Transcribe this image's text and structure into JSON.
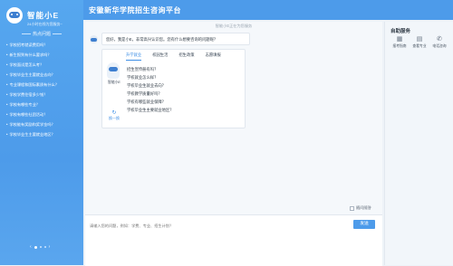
{
  "sidebar": {
    "brand_name": "智能小E",
    "brand_sub": "24小时在线为您服务~",
    "hot_title": "热点问题",
    "hot_items": [
      "学校招考就读费用吗？",
      "新生报到有什么要求吗？",
      "学校面试是怎么考？",
      "学校毕业生主要就业去向？",
      "专业课程和国际素质有什么？",
      "学校学费住宿多少钱？",
      "学校有哪些专业？",
      "学校有哪些社团活动？",
      "学校能有奖励和奖学金吗？",
      "学校毕业生主要就业地区？"
    ],
    "pager_prev": "‹",
    "pager_next": "›"
  },
  "header": {
    "title": "安徽新华学院招生咨询平台"
  },
  "chat": {
    "status": "智能小E正在为您服务",
    "welcome": "您好，我是小E，非常高兴认识您。您有什么想要咨询的问题呢？",
    "bot_name": "智能小E",
    "refresh_label": "换一换",
    "refresh_icon": "↻",
    "tabs": [
      "升学就业",
      "校园生活",
      "招生政策",
      "志愿填报"
    ],
    "active_tab": 0,
    "questions": [
      "招生宣传册有吗？",
      "学校就业怎么样？",
      "学校毕业生就业去向？",
      "学校教学质量好吗？",
      "学校有哪些就业保障？",
      "学校毕业生主要就业地区？"
    ]
  },
  "right": {
    "title": "自助服务",
    "services": [
      {
        "label": "报考指南",
        "icon": "▦"
      },
      {
        "label": "查看专业",
        "icon": "▤"
      },
      {
        "label": "电话咨询",
        "icon": "✆"
      }
    ]
  },
  "input": {
    "placeholder": "请输入您的问题，例如：学费、专业、招生计划？",
    "send_label": "发送",
    "toggle_label": "随问随答"
  }
}
